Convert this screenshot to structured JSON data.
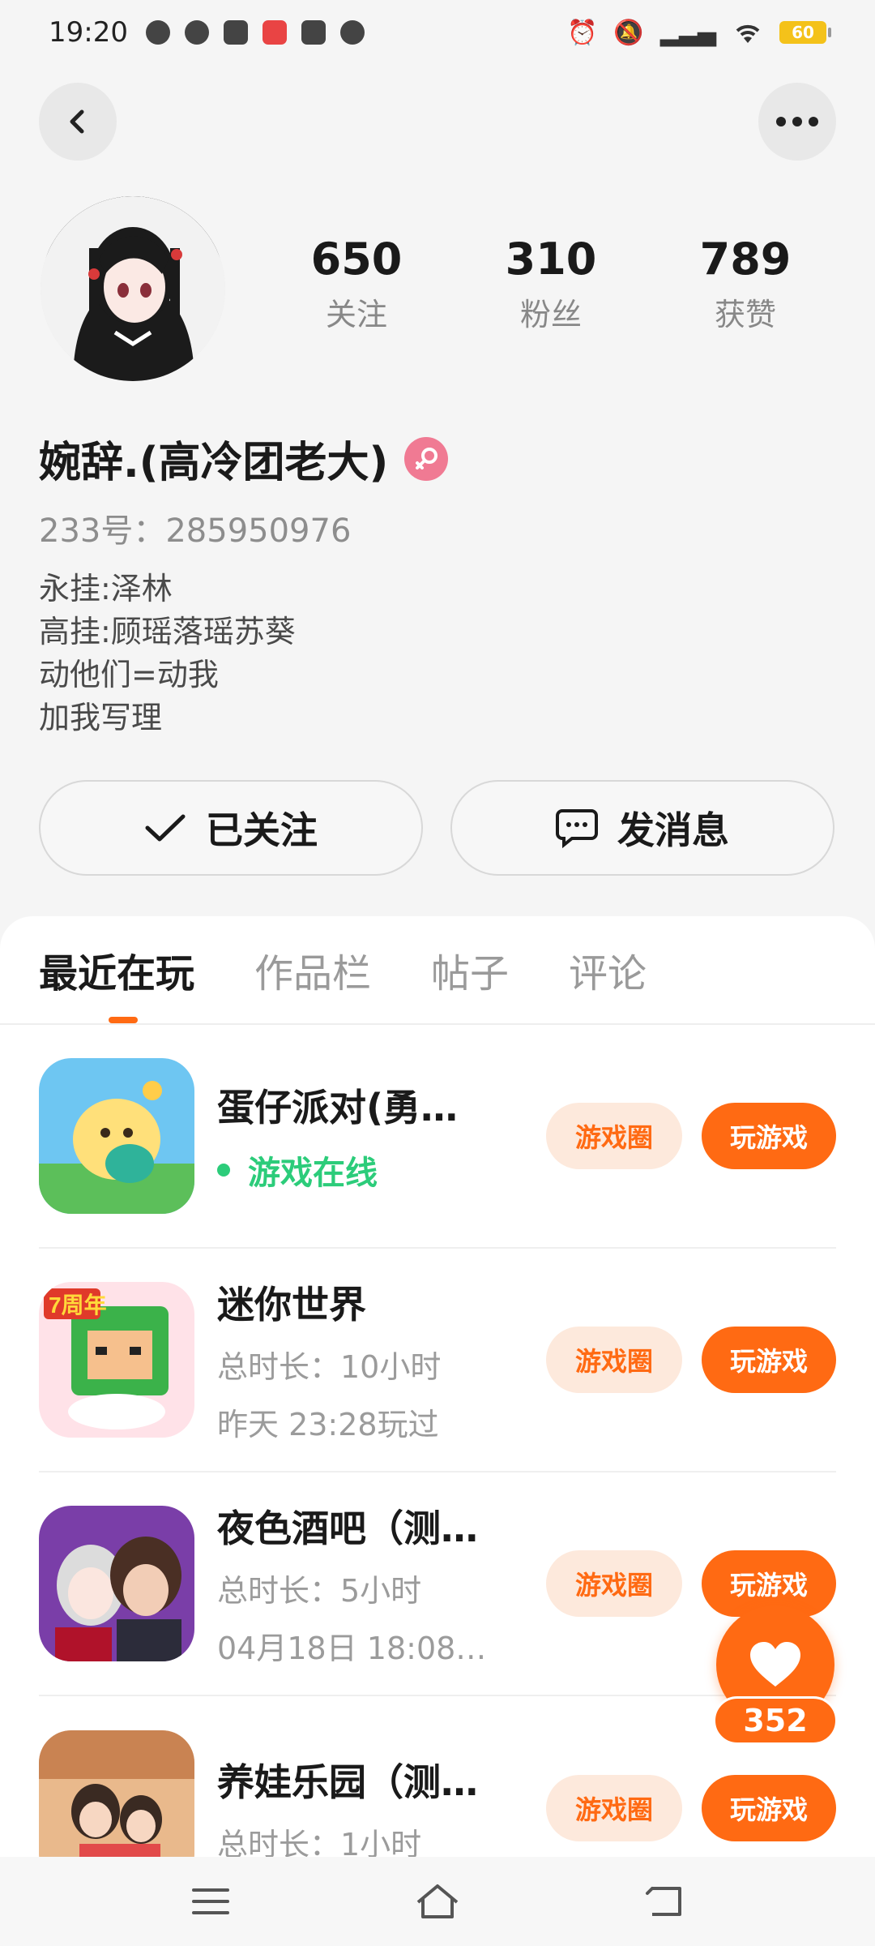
{
  "status_bar": {
    "time": "19:20",
    "battery": "60"
  },
  "profile": {
    "following_count": "650",
    "following_label": "关注",
    "fans_count": "310",
    "fans_label": "粉丝",
    "likes_count": "789",
    "likes_label": "获赞",
    "nickname": "婉辞.(高冷团老大)",
    "id_line": "233号：285950976",
    "bio": [
      "永挂:泽林",
      "高挂:顾瑶落瑶苏葵",
      "动他们=动我",
      "加我写理"
    ]
  },
  "actions": {
    "follow_label": "已关注",
    "message_label": "发消息"
  },
  "tabs": [
    "最近在玩",
    "作品栏",
    "帖子",
    "评论"
  ],
  "games": [
    {
      "title": "蛋仔派对(勇…",
      "status": "游戏在线",
      "circle": "游戏圈",
      "play": "玩游戏"
    },
    {
      "title": "迷你世界",
      "meta1": "总时长：10小时",
      "meta2": "昨天 23:28玩过",
      "circle": "游戏圈",
      "play": "玩游戏"
    },
    {
      "title": "夜色酒吧（测…",
      "meta1": "总时长：5小时",
      "meta2": "04月18日 18:08…",
      "circle": "游戏圈",
      "play": "玩游戏"
    },
    {
      "title": "养娃乐园（测…",
      "meta1": "总时长：1小时",
      "circle": "游戏圈",
      "play": "玩游戏"
    }
  ],
  "like_fab": {
    "count": "352"
  },
  "colors": {
    "accent": "#ff6a13",
    "online": "#2ccc7a"
  }
}
